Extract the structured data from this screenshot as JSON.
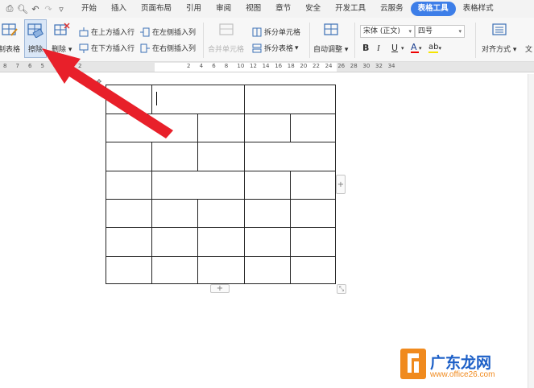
{
  "menu": {
    "tabs": [
      "开始",
      "插入",
      "页面布局",
      "引用",
      "审阅",
      "视图",
      "章节",
      "安全",
      "开发工具",
      "云服务",
      "表格工具",
      "表格样式"
    ],
    "active_tab": "表格工具"
  },
  "ribbon": {
    "draw_table": "制表格",
    "erase": "擦除",
    "delete": "删除",
    "insert_above": "在上方插入行",
    "insert_below": "在下方插入行",
    "insert_left": "在左侧插入列",
    "insert_right": "在右侧插入列",
    "merge_cells": "合并单元格",
    "split_cells": "拆分单元格",
    "split_table": "拆分表格",
    "auto_fit": "自动调整",
    "font_name": "宋体 (正文)",
    "font_size": "四号",
    "bold": "B",
    "italic": "I",
    "underline": "U",
    "font_color": "A",
    "highlight": "ab",
    "align": "对齐方式",
    "text_dir": "文"
  },
  "ruler": {
    "left_numbers": [
      "8",
      "7",
      "6",
      "5",
      "4",
      "3",
      "2"
    ],
    "right_numbers": [
      "2",
      "4",
      "6",
      "8",
      "10",
      "12",
      "14",
      "16",
      "18",
      "20",
      "22",
      "24",
      "26",
      "28",
      "30",
      "32",
      "34"
    ]
  },
  "watermark": {
    "name": "广东龙网",
    "url": "www.office26.com"
  },
  "colors": {
    "accent": "#3d7ee8",
    "arrow": "#e8202a",
    "watermark_orange": "#f08a1e"
  }
}
